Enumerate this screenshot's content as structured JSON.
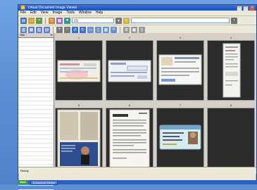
{
  "window": {
    "title": "Virtual Document Image Viewer"
  },
  "menu": [
    "File",
    "Edit",
    "View",
    "Image",
    "Tools",
    "Window",
    "Help"
  ],
  "toolbar": {
    "page_field": "(1)"
  },
  "sidebar": {
    "header_left": "Title",
    "header_right": "▾"
  },
  "grid": {
    "cell_labels": [
      "1",
      "2",
      "3",
      "4",
      "5",
      "6",
      "7",
      "8"
    ]
  },
  "statusbar": {
    "left": "Ready"
  },
  "taskbar": {
    "start": "start",
    "task": "Document Viewer"
  },
  "colors": {
    "accent": "#1d4fb3",
    "desktop": "#5b8fd1",
    "panel": "#2c2c2c"
  }
}
